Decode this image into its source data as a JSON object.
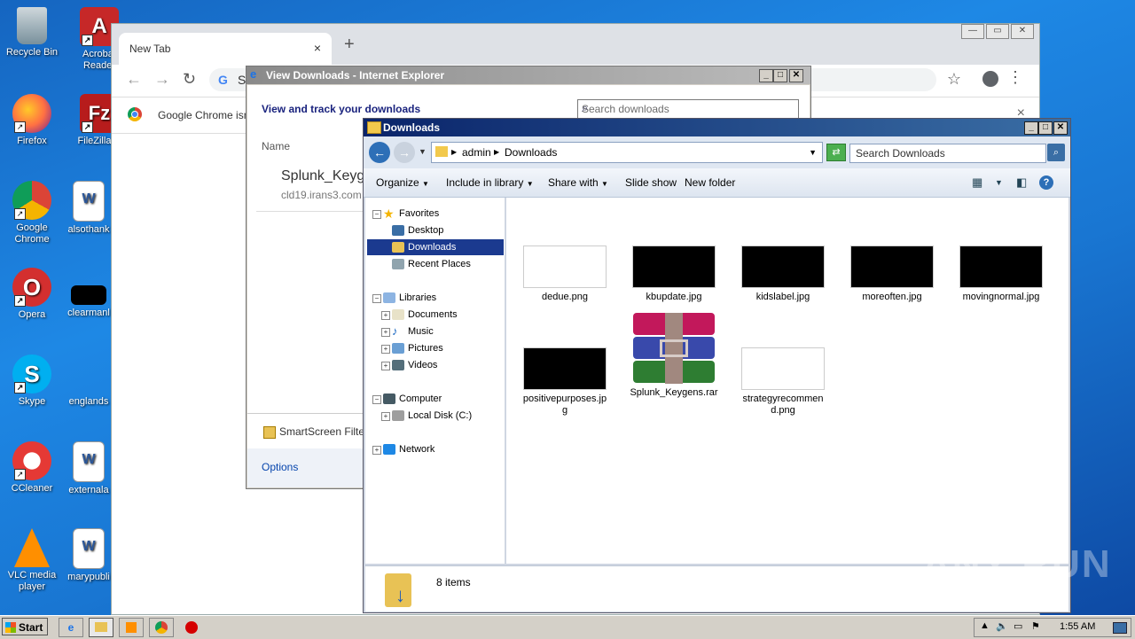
{
  "desktop": {
    "icons": [
      {
        "label": "Recycle Bin"
      },
      {
        "label": "Acrobat Reader"
      },
      {
        "label": "Firefox"
      },
      {
        "label": "FileZilla C"
      },
      {
        "label": "Google Chrome"
      },
      {
        "label": "alsothank"
      },
      {
        "label": "Opera"
      },
      {
        "label": "clearmanl"
      },
      {
        "label": "Skype"
      },
      {
        "label": "englands"
      },
      {
        "label": "CCleaner"
      },
      {
        "label": "externala"
      },
      {
        "label": "VLC media player"
      },
      {
        "label": "marypubli"
      }
    ]
  },
  "chrome": {
    "tab_title": "New Tab",
    "tab_close": "×",
    "new_tab": "+",
    "omnibox_text": "S",
    "infobar_text": "Google Chrome isn",
    "infobar_close": "×"
  },
  "ie_downloads": {
    "title": "View Downloads - Internet Explorer",
    "heading": "View and track your downloads",
    "search_placeholder": "Search downloads",
    "column_name": "Name",
    "file_name": "Splunk_Keyg",
    "file_source": "cld19.irans3.com",
    "smartscreen": "SmartScreen Filte",
    "options": "Options"
  },
  "explorer": {
    "title": "Downloads",
    "path": [
      "admin",
      "Downloads"
    ],
    "search_placeholder": "Search Downloads",
    "commands": {
      "organize": "Organize",
      "include": "Include in library",
      "share": "Share with",
      "slideshow": "Slide show",
      "newfolder": "New folder"
    },
    "nav": {
      "favorites": "Favorites",
      "desktop": "Desktop",
      "downloads": "Downloads",
      "recent": "Recent Places",
      "libraries": "Libraries",
      "documents": "Documents",
      "music": "Music",
      "pictures": "Pictures",
      "videos": "Videos",
      "computer": "Computer",
      "localdisk": "Local Disk (C:)",
      "network": "Network"
    },
    "files": [
      {
        "name": "dedue.png"
      },
      {
        "name": "kbupdate.jpg"
      },
      {
        "name": "kidslabel.jpg"
      },
      {
        "name": "moreoften.jpg"
      },
      {
        "name": "movingnormal.jpg"
      },
      {
        "name": "positivepurposes.jpg"
      },
      {
        "name": "Splunk_Keygens.rar"
      },
      {
        "name": "strategyrecommend.png"
      }
    ],
    "status": "8 items"
  },
  "taskbar": {
    "start": "Start",
    "clock": "1:55 AM"
  },
  "watermark": "ANY RUN"
}
